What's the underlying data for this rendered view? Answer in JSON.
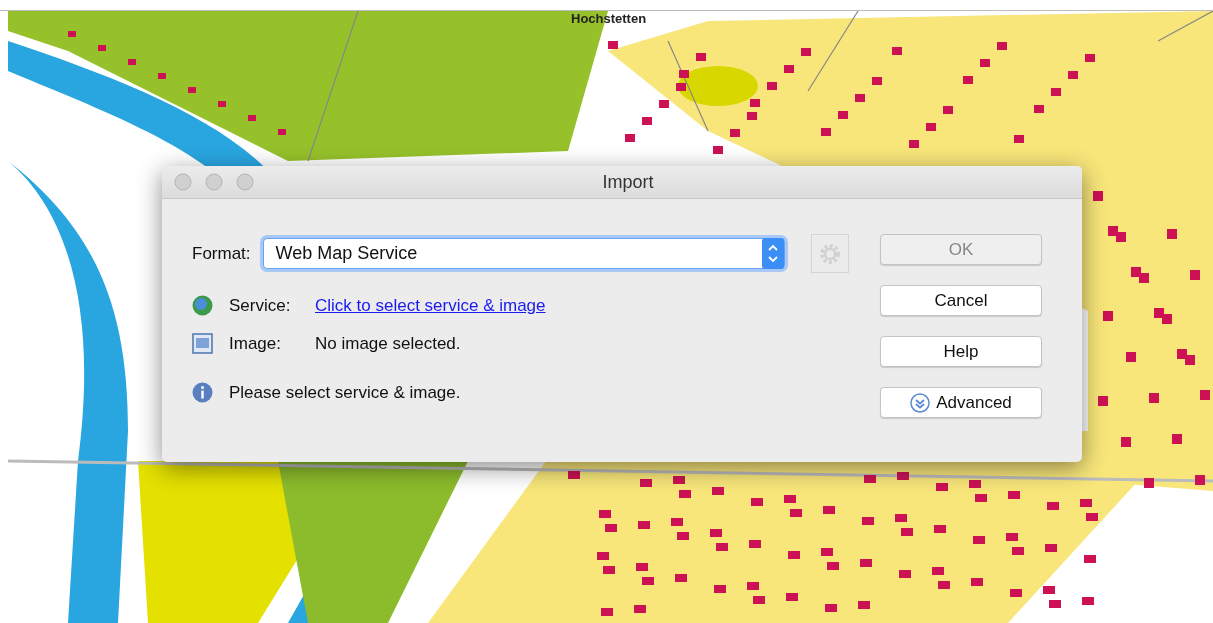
{
  "map": {
    "labels": [
      {
        "text": "Hochstetten"
      }
    ]
  },
  "dialog": {
    "title": "Import",
    "format": {
      "label": "Format:",
      "value": "Web Map Service",
      "settings_disabled": true
    },
    "rows": [
      {
        "kind": "globe",
        "label": "Service:",
        "value": "Click to select service & image",
        "link": true
      },
      {
        "kind": "image",
        "label": "Image:",
        "value": "No image selected.",
        "link": false
      }
    ],
    "status": {
      "kind": "info",
      "text": "Please select service & image."
    },
    "buttons": [
      {
        "label": "OK",
        "disabled": true,
        "kind": "plain"
      },
      {
        "label": "Cancel",
        "disabled": false,
        "kind": "plain"
      },
      {
        "label": "Help",
        "disabled": false,
        "kind": "plain"
      },
      {
        "label": "Advanced",
        "disabled": false,
        "kind": "disclosure"
      }
    ]
  }
}
